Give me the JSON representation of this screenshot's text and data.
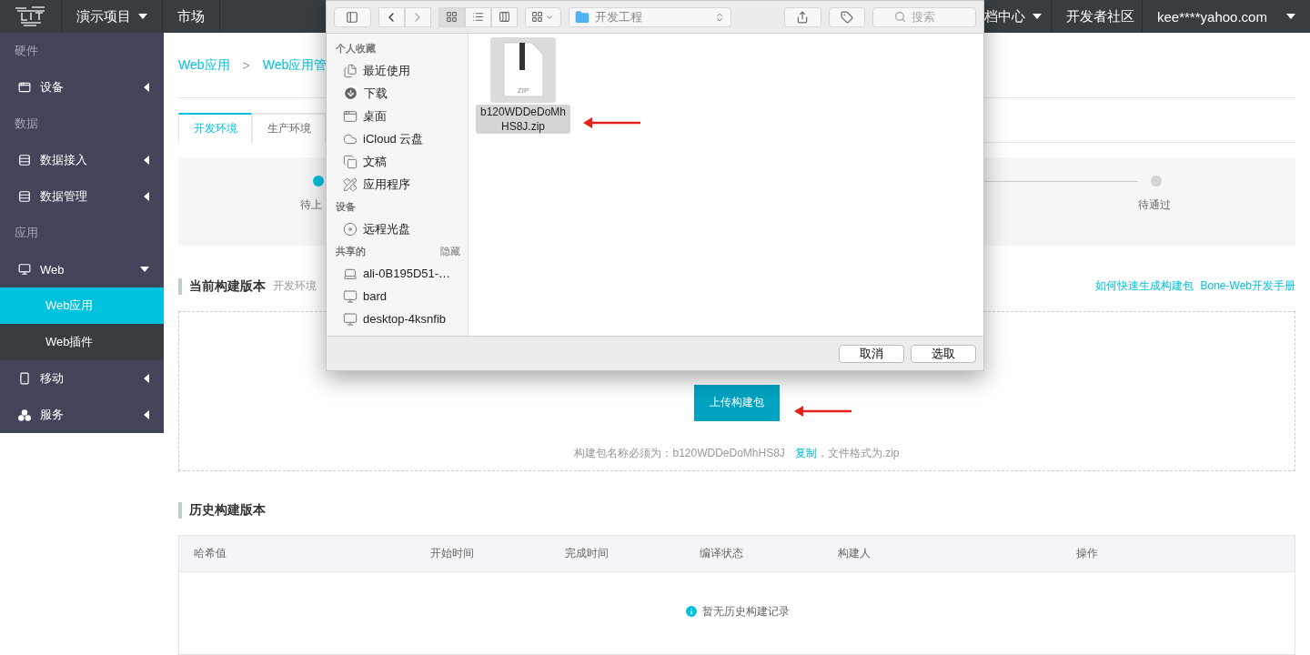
{
  "topnav": {
    "left": [
      {
        "label": "演示项目",
        "dropdown": true
      },
      {
        "label": "市场"
      }
    ],
    "right": [
      {
        "label": "档中心",
        "dropdown": true
      },
      {
        "label": "开发者社区"
      },
      {
        "label": "kee****yahoo.com",
        "dropdown": true
      }
    ]
  },
  "sidebar": {
    "sections": [
      {
        "title": "硬件",
        "items": [
          {
            "label": "设备",
            "expanded": false
          }
        ]
      },
      {
        "title": "数据",
        "items": [
          {
            "label": "数据接入",
            "expanded": false
          },
          {
            "label": "数据管理",
            "expanded": false
          }
        ]
      },
      {
        "title": "应用",
        "items": [
          {
            "label": "Web",
            "expanded": true,
            "children": [
              {
                "label": "Web应用",
                "selected": true
              },
              {
                "label": "Web插件",
                "selected": false
              }
            ]
          },
          {
            "label": "移动",
            "expanded": false
          },
          {
            "label": "服务",
            "expanded": false
          }
        ]
      }
    ]
  },
  "main": {
    "breadcrumb": {
      "items": [
        "Web应用",
        "Web应用管"
      ],
      "separator": ">"
    },
    "tabs": [
      {
        "label": "开发环境",
        "selected": true
      },
      {
        "label": "生产环境",
        "selected": false
      }
    ],
    "steps": [
      {
        "label": "待上",
        "active": true
      },
      {
        "label": "待通过",
        "active": false
      }
    ],
    "current_build": {
      "title": "当前构建版本",
      "subtitle": "开发环境",
      "links": [
        "如何快速生成构建包",
        "Bone-Web开发手册"
      ],
      "upload_button": "上传构建包",
      "hint_before": "构建包名称必须为：b120WDDeDoMhHS8J",
      "hint_link": "复制",
      "hint_after": "，文件格式为.zip"
    },
    "history": {
      "title": "历史构建版本",
      "columns": [
        "哈希值",
        "开始时间",
        "完成时间",
        "编译状态",
        "构建人",
        "操作"
      ],
      "empty": "暂无历史构建记录"
    }
  },
  "dialog": {
    "view_modes": [
      {
        "selected": true
      },
      {
        "selected": false
      },
      {
        "selected": false
      }
    ],
    "location": "开发工程",
    "search_placeholder": "搜索",
    "groups": [
      {
        "title": "个人收藏",
        "items": [
          "最近使用",
          "下载",
          "桌面",
          "iCloud 云盘",
          "文稿",
          "应用程序"
        ]
      },
      {
        "title": "设备",
        "items": [
          "远程光盘"
        ]
      },
      {
        "title": "共享的",
        "action": "隐藏",
        "items": [
          "ali-0B195D51-…",
          "bard",
          "desktop-4ksnfib"
        ]
      }
    ],
    "files": [
      {
        "name": "b120WDDeDoMhHS8J.zip",
        "type_label": "ZIP",
        "selected": true
      }
    ],
    "buttons": [
      "取消",
      "选取"
    ]
  }
}
